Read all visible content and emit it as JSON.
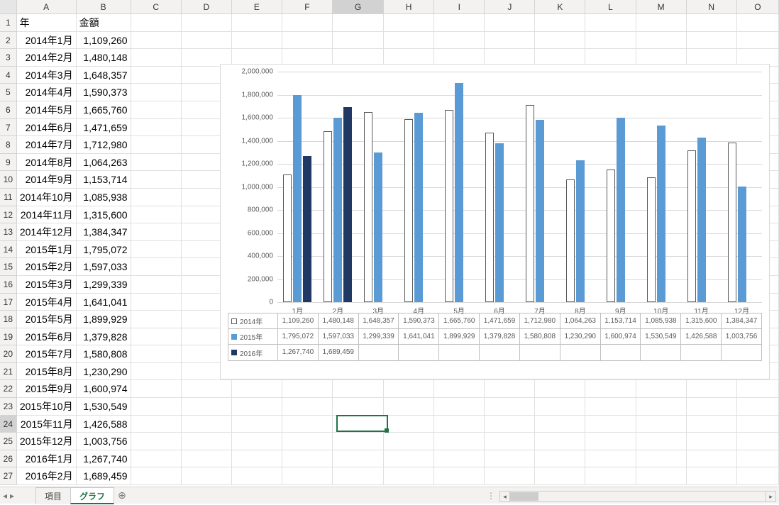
{
  "columns": [
    "A",
    "B",
    "C",
    "D",
    "E",
    "F",
    "G",
    "H",
    "I",
    "J",
    "K",
    "L",
    "M",
    "N",
    "O"
  ],
  "selected_column_index": 6,
  "selected_row": 24,
  "selected_cell_ref": "G24",
  "headers": {
    "A": "年",
    "B": "金額"
  },
  "rows": [
    {
      "n": 1,
      "a": "年",
      "b": "金額",
      "header": true
    },
    {
      "n": 2,
      "a": "2014年1月",
      "b": "1,109,260"
    },
    {
      "n": 3,
      "a": "2014年2月",
      "b": "1,480,148"
    },
    {
      "n": 4,
      "a": "2014年3月",
      "b": "1,648,357"
    },
    {
      "n": 5,
      "a": "2014年4月",
      "b": "1,590,373"
    },
    {
      "n": 6,
      "a": "2014年5月",
      "b": "1,665,760"
    },
    {
      "n": 7,
      "a": "2014年6月",
      "b": "1,471,659"
    },
    {
      "n": 8,
      "a": "2014年7月",
      "b": "1,712,980"
    },
    {
      "n": 9,
      "a": "2014年8月",
      "b": "1,064,263"
    },
    {
      "n": 10,
      "a": "2014年9月",
      "b": "1,153,714"
    },
    {
      "n": 11,
      "a": "2014年10月",
      "b": "1,085,938"
    },
    {
      "n": 12,
      "a": "2014年11月",
      "b": "1,315,600"
    },
    {
      "n": 13,
      "a": "2014年12月",
      "b": "1,384,347"
    },
    {
      "n": 14,
      "a": "2015年1月",
      "b": "1,795,072"
    },
    {
      "n": 15,
      "a": "2015年2月",
      "b": "1,597,033"
    },
    {
      "n": 16,
      "a": "2015年3月",
      "b": "1,299,339"
    },
    {
      "n": 17,
      "a": "2015年4月",
      "b": "1,641,041"
    },
    {
      "n": 18,
      "a": "2015年5月",
      "b": "1,899,929"
    },
    {
      "n": 19,
      "a": "2015年6月",
      "b": "1,379,828"
    },
    {
      "n": 20,
      "a": "2015年7月",
      "b": "1,580,808"
    },
    {
      "n": 21,
      "a": "2015年8月",
      "b": "1,230,290"
    },
    {
      "n": 22,
      "a": "2015年9月",
      "b": "1,600,974"
    },
    {
      "n": 23,
      "a": "2015年10月",
      "b": "1,530,549"
    },
    {
      "n": 24,
      "a": "2015年11月",
      "b": "1,426,588"
    },
    {
      "n": 25,
      "a": "2015年12月",
      "b": "1,003,756"
    },
    {
      "n": 26,
      "a": "2016年1月",
      "b": "1,267,740"
    },
    {
      "n": 27,
      "a": "2016年2月",
      "b": "1,689,459"
    }
  ],
  "tabs": {
    "items": [
      "項目",
      "グラフ"
    ],
    "active": 1,
    "add_icon": "⊕"
  },
  "nav": {
    "prev": "◂",
    "next": "▸"
  },
  "chart_data": {
    "type": "bar",
    "categories": [
      "1月",
      "2月",
      "3月",
      "4月",
      "5月",
      "6月",
      "7月",
      "8月",
      "9月",
      "10月",
      "11月",
      "12月"
    ],
    "series": [
      {
        "name": "2014年",
        "values": [
          1109260,
          1480148,
          1648357,
          1590373,
          1665760,
          1471659,
          1712980,
          1064263,
          1153714,
          1085938,
          1315600,
          1384347
        ]
      },
      {
        "name": "2015年",
        "values": [
          1795072,
          1597033,
          1299339,
          1641041,
          1899929,
          1379828,
          1580808,
          1230290,
          1600974,
          1530549,
          1426588,
          1003756
        ]
      },
      {
        "name": "2016年",
        "values": [
          1267740,
          1689459,
          null,
          null,
          null,
          null,
          null,
          null,
          null,
          null,
          null,
          null
        ]
      }
    ],
    "ylim": [
      0,
      2000000
    ],
    "yticks": [
      0,
      200000,
      400000,
      600000,
      800000,
      1000000,
      1200000,
      1400000,
      1600000,
      1800000,
      2000000
    ],
    "ytick_labels": [
      "0",
      "200,000",
      "400,000",
      "600,000",
      "800,000",
      "1,000,000",
      "1,200,000",
      "1,400,000",
      "1,600,000",
      "1,800,000",
      "2,000,000"
    ]
  }
}
